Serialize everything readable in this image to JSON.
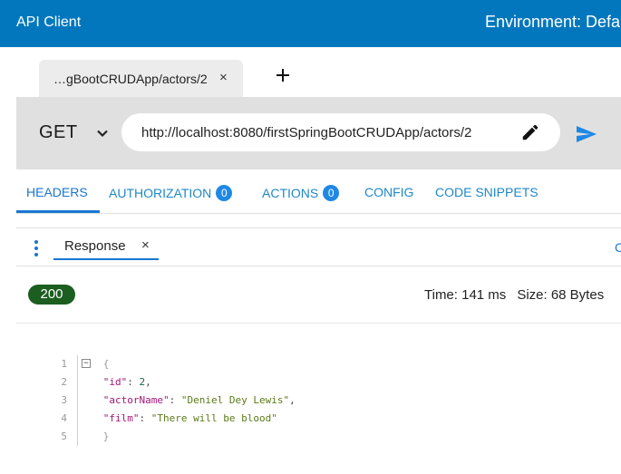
{
  "app": {
    "title": "API Client",
    "environment": "Environment: Defa"
  },
  "tabs": [
    {
      "label": "…gBootCRUDApp/actors/2",
      "close": "×"
    }
  ],
  "request": {
    "method": "GET",
    "url": "http://localhost:8080/firstSpringBootCRUDApp/actors/2"
  },
  "request_tabs": [
    {
      "label": "HEADERS"
    },
    {
      "label": "AUTHORIZATION",
      "badge": "0"
    },
    {
      "label": "ACTIONS",
      "badge": "0"
    },
    {
      "label": "CONFIG"
    },
    {
      "label": "CODE SNIPPETS"
    }
  ],
  "response": {
    "tab_label": "Response",
    "close": "×",
    "edge_text": "C",
    "status": "200",
    "time": "Time: 141 ms",
    "size": "Size: 68 Bytes",
    "body": {
      "line_numbers": [
        "1",
        "2",
        "3",
        "4",
        "5"
      ],
      "fold": "−",
      "open": "{",
      "close": "}",
      "fields": [
        {
          "key": "\"id\"",
          "value": "2",
          "sep": ","
        },
        {
          "key": "\"actorName\"",
          "value": "\"Deniel Dey Lewis\"",
          "sep": ","
        },
        {
          "key": "\"film\"",
          "value": "\"There will be blood\"",
          "sep": ""
        }
      ]
    }
  },
  "colors": {
    "header": "#0277bd",
    "accent": "#1976d2",
    "status_ok": "#1b5e20"
  },
  "icons": [
    "add-tab-icon",
    "chevron-down-icon",
    "edit-pencil-icon",
    "send-icon",
    "more-vert-icon",
    "close-icon",
    "fold-toggle-icon"
  ]
}
